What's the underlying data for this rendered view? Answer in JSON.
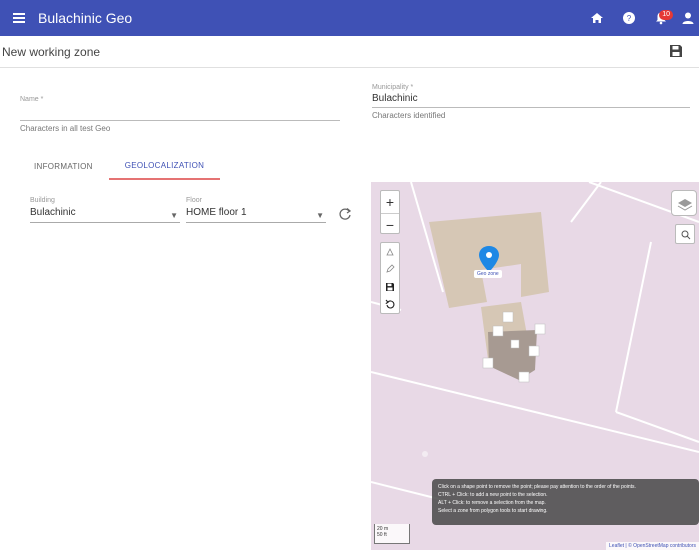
{
  "app": {
    "title": "Bulachinic Geo"
  },
  "header": {
    "notification_count": "10"
  },
  "page": {
    "title": "New working zone"
  },
  "form": {
    "name": {
      "label": "Name *",
      "value": "",
      "hint": "Characters in all test Geo"
    },
    "municipality": {
      "label": "Municipality *",
      "value": "Bulachinic",
      "hint": "Characters identified"
    }
  },
  "tabs": [
    {
      "label": "INFORMATION"
    },
    {
      "label": "GEOLOCALIZATION"
    }
  ],
  "geo": {
    "building": {
      "label": "Building",
      "value": "Bulachinic"
    },
    "floor": {
      "label": "Floor",
      "value": "HOME floor 1"
    }
  },
  "map": {
    "zoom_in": "+",
    "zoom_out": "−",
    "marker_label": "Geo zone",
    "help_lines": [
      "Click on a shape point to remove the point; please pay attention to the order of the points.",
      "CTRL + Click: to add a new point to the selection.",
      "ALT + Click: to remove a selection from the map.",
      "Select a zone from polygon tools to start drawing."
    ],
    "scale_top": "20 m",
    "scale_bottom": "50 ft",
    "attribution": "Leaflet | © OpenStreetMap contributors"
  }
}
